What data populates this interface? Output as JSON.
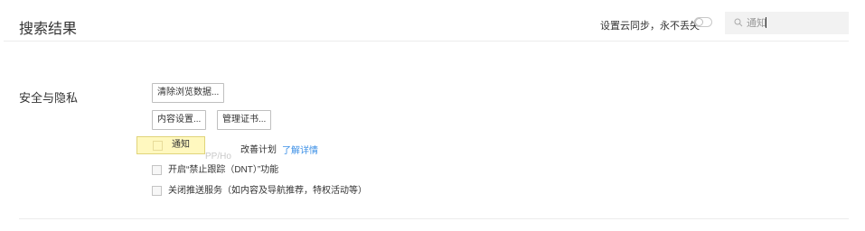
{
  "header": {
    "title": "搜索结果",
    "sync_label": "设置云同步，永不丢失",
    "sync_toggle_on": false
  },
  "search": {
    "value": "通知",
    "icon": "search-icon"
  },
  "section": {
    "label": "安全与隐私"
  },
  "buttons": {
    "clear_browsing": "清除浏览数据...",
    "content_settings": "内容设置...",
    "manage_certs": "管理证书..."
  },
  "options": [
    {
      "label": "改善计划",
      "link": "了解详情",
      "checked": false
    },
    {
      "label": "开启“禁止跟踪（DNT）”功能",
      "checked": false
    },
    {
      "label": "关闭推送服务（如内容及导航推荐，特权活动等）",
      "checked": false
    }
  ],
  "tooltip": {
    "text": "通知"
  },
  "colors": {
    "link": "#3b8fe6",
    "tooltip_bg": "#fff8bf",
    "search_bg": "#f2f2f2"
  }
}
